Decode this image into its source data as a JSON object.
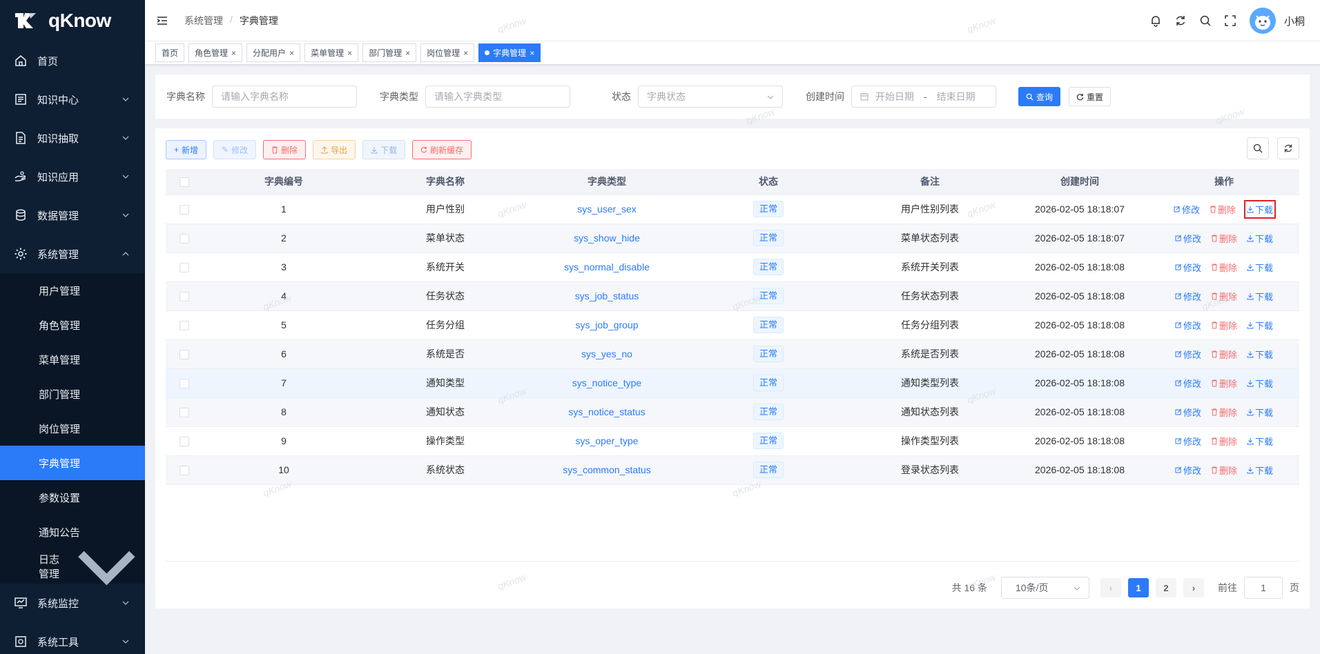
{
  "brand": {
    "logo_text": "qKnow"
  },
  "sidebar": {
    "items": [
      {
        "label": "首页",
        "icon": "home-icon",
        "chevron": false
      },
      {
        "label": "知识中心",
        "icon": "book-icon",
        "chevron": true
      },
      {
        "label": "知识抽取",
        "icon": "document-icon",
        "chevron": true
      },
      {
        "label": "知识应用",
        "icon": "hand-icon",
        "chevron": true
      },
      {
        "label": "数据管理",
        "icon": "database-icon",
        "chevron": true
      },
      {
        "label": "系统管理",
        "icon": "gear-icon",
        "chevron": true,
        "expanded": true
      }
    ],
    "submenu": [
      {
        "label": "用户管理"
      },
      {
        "label": "角色管理"
      },
      {
        "label": "菜单管理"
      },
      {
        "label": "部门管理"
      },
      {
        "label": "岗位管理"
      },
      {
        "label": "字典管理",
        "active": true
      },
      {
        "label": "参数设置"
      },
      {
        "label": "通知公告"
      },
      {
        "label": "日志管理",
        "chevron": true
      }
    ],
    "bottom_items": [
      {
        "label": "系统监控",
        "icon": "monitor-icon"
      },
      {
        "label": "系统工具",
        "icon": "tool-icon"
      }
    ]
  },
  "header": {
    "breadcrumb": [
      "系统管理",
      "字典管理"
    ],
    "breadcrumb_sep": "/",
    "username": "小桐"
  },
  "tags": [
    {
      "label": "首页",
      "closable": false,
      "active": false
    },
    {
      "label": "角色管理",
      "closable": true,
      "active": false
    },
    {
      "label": "分配用户",
      "closable": true,
      "active": false
    },
    {
      "label": "菜单管理",
      "closable": true,
      "active": false
    },
    {
      "label": "部门管理",
      "closable": true,
      "active": false
    },
    {
      "label": "岗位管理",
      "closable": true,
      "active": false
    },
    {
      "label": "字典管理",
      "closable": true,
      "active": true
    }
  ],
  "search": {
    "name_label": "字典名称",
    "name_placeholder": "请输入字典名称",
    "type_label": "字典类型",
    "type_placeholder": "请输入字典类型",
    "status_label": "状态",
    "status_placeholder": "字典状态",
    "date_label": "创建时间",
    "date_start_placeholder": "开始日期",
    "date_sep": "-",
    "date_end_placeholder": "结束日期",
    "query_label": "查询",
    "reset_label": "重置"
  },
  "toolbar": {
    "add_label": "新增",
    "edit_label": "修改",
    "delete_label": "删除",
    "export_label": "导出",
    "download_label": "下载",
    "refresh_cache_label": "刷新缓存"
  },
  "table": {
    "columns": [
      "字典编号",
      "字典名称",
      "字典类型",
      "状态",
      "备注",
      "创建时间",
      "操作"
    ],
    "op_edit": "修改",
    "op_delete": "删除",
    "op_download": "下载",
    "rows": [
      {
        "id": "1",
        "name": "用户性别",
        "type": "sys_user_sex",
        "status": "正常",
        "remark": "用户性别列表",
        "created": "2026-02-05 18:18:07"
      },
      {
        "id": "2",
        "name": "菜单状态",
        "type": "sys_show_hide",
        "status": "正常",
        "remark": "菜单状态列表",
        "created": "2026-02-05 18:18:07"
      },
      {
        "id": "3",
        "name": "系统开关",
        "type": "sys_normal_disable",
        "status": "正常",
        "remark": "系统开关列表",
        "created": "2026-02-05 18:18:08"
      },
      {
        "id": "4",
        "name": "任务状态",
        "type": "sys_job_status",
        "status": "正常",
        "remark": "任务状态列表",
        "created": "2026-02-05 18:18:08"
      },
      {
        "id": "5",
        "name": "任务分组",
        "type": "sys_job_group",
        "status": "正常",
        "remark": "任务分组列表",
        "created": "2026-02-05 18:18:08"
      },
      {
        "id": "6",
        "name": "系统是否",
        "type": "sys_yes_no",
        "status": "正常",
        "remark": "系统是否列表",
        "created": "2026-02-05 18:18:08"
      },
      {
        "id": "7",
        "name": "通知类型",
        "type": "sys_notice_type",
        "status": "正常",
        "remark": "通知类型列表",
        "created": "2026-02-05 18:18:08"
      },
      {
        "id": "8",
        "name": "通知状态",
        "type": "sys_notice_status",
        "status": "正常",
        "remark": "通知状态列表",
        "created": "2026-02-05 18:18:08"
      },
      {
        "id": "9",
        "name": "操作类型",
        "type": "sys_oper_type",
        "status": "正常",
        "remark": "操作类型列表",
        "created": "2026-02-05 18:18:08"
      },
      {
        "id": "10",
        "name": "系统状态",
        "type": "sys_common_status",
        "status": "正常",
        "remark": "登录状态列表",
        "created": "2026-02-05 18:18:08"
      }
    ]
  },
  "pagination": {
    "total_text": "共 16 条",
    "page_size": "10条/页",
    "pages": [
      "1",
      "2"
    ],
    "current": "1",
    "goto_label": "前往",
    "goto_value": "1",
    "page_suffix": "页"
  },
  "watermark": "qKnow",
  "colors": {
    "primary": "#2b7bf8",
    "sidebar_bg": "#0f1f33",
    "danger": "#f56c6c",
    "warning": "#e6a23c"
  }
}
